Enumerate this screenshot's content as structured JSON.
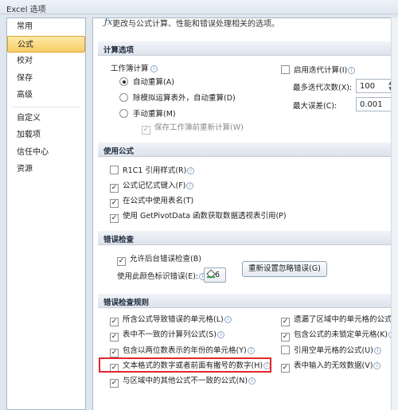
{
  "window": {
    "title": "Excel 选项"
  },
  "nav": {
    "items": [
      {
        "label": "常用"
      },
      {
        "label": "公式"
      },
      {
        "label": "校对"
      },
      {
        "label": "保存"
      },
      {
        "label": "高级"
      },
      {
        "label": "自定义"
      },
      {
        "label": "加载项"
      },
      {
        "label": "信任中心"
      },
      {
        "label": "资源"
      }
    ],
    "active_index": 1
  },
  "intro": {
    "text": "更改与公式计算、性能和错误处理相关的选项。"
  },
  "calc": {
    "header": "计算选项",
    "workbook_label": "工作簿计算",
    "auto": "自动重算(A)",
    "auto_except": "除模拟运算表外，自动重算(D)",
    "manual": "手动重算(M)",
    "recalc_before_save": "保存工作簿前重新计算(W)",
    "iterative": "启用迭代计算(I)",
    "max_iter_label": "最多迭代次数(X):",
    "max_iter_value": "100",
    "max_change_label": "最大误差(C):",
    "max_change_value": "0.001"
  },
  "formulas": {
    "header": "使用公式",
    "r1c1": "R1C1 引用样式(R)",
    "autocomplete": "公式记忆式键入(F)",
    "table_names": "在公式中使用表名(T)",
    "getpivotdata": "使用 GetPivotData 函数获取数据透视表引用(P)"
  },
  "errors": {
    "header": "错误检查",
    "background": "允许后台错误检查(B)",
    "color_label": "使用此颜色标识错误(E):",
    "color_value": "6",
    "reset_button": "重新设置忽略错误(G)"
  },
  "rules": {
    "header": "错误检查规则",
    "left": [
      {
        "label": "所含公式导致错误的单元格(L)",
        "checked": true
      },
      {
        "label": "表中不一致的计算列公式(S)",
        "checked": true
      },
      {
        "label": "包含以两位数表示的年份的单元格(Y)",
        "checked": true
      },
      {
        "label": "文本格式的数字或者前面有撇号的数字(H)",
        "checked": true
      },
      {
        "label": "与区域中的其他公式不一致的公式(N)",
        "checked": true
      }
    ],
    "right": [
      {
        "label": "遗漏了区域中的单元格的公式(O)",
        "checked": true
      },
      {
        "label": "包含公式的未锁定单元格(K)",
        "checked": true
      },
      {
        "label": "引用空单元格的公式(U)",
        "checked": false
      },
      {
        "label": "表中输入的无效数据(V)",
        "checked": true
      }
    ]
  },
  "icons": {
    "info": "info-icon",
    "check": "✓",
    "intro": "function-icon",
    "fill_color": "fill-color-icon"
  },
  "colors": {
    "accent": "#f8cd66",
    "highlight_border": "#e3262b",
    "error_color": "#3c9a48"
  }
}
